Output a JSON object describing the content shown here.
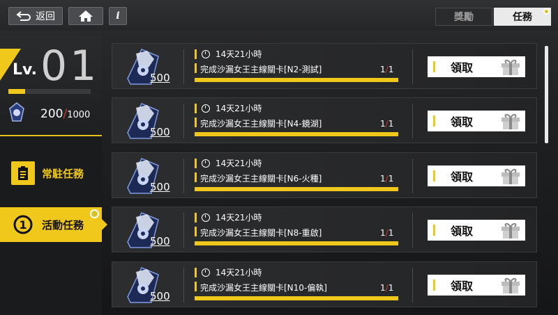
{
  "topbar": {
    "back_label": "返回",
    "info_label": "i",
    "tabs": [
      {
        "label": "獎勵",
        "active": false
      },
      {
        "label": "任務",
        "active": true
      }
    ]
  },
  "player": {
    "lv_prefix": "Lv.",
    "level": "01",
    "xp_fraction": 0.2,
    "stamina": "200",
    "stamina_max": "1000"
  },
  "sidebar": {
    "items": [
      {
        "label": "常駐任務",
        "active": false
      },
      {
        "label": "活動任務",
        "active": true
      }
    ]
  },
  "missions": [
    {
      "reward": "500",
      "time": "14天21小時",
      "desc": "完成沙漏女王主線關卡[N2-測試]",
      "progress": "1",
      "total": "1",
      "claim": "領取"
    },
    {
      "reward": "500",
      "time": "14天21小時",
      "desc": "完成沙漏女王主線關卡[N4-鏡湖]",
      "progress": "1",
      "total": "1",
      "claim": "領取"
    },
    {
      "reward": "500",
      "time": "14天21小時",
      "desc": "完成沙漏女王主線關卡[N6-火種]",
      "progress": "1",
      "total": "1",
      "claim": "領取"
    },
    {
      "reward": "500",
      "time": "14天21小時",
      "desc": "完成沙漏女王主線關卡[N8-重啟]",
      "progress": "1",
      "total": "1",
      "claim": "領取"
    },
    {
      "reward": "500",
      "time": "14天21小時",
      "desc": "完成沙漏女王主線關卡[N10-偏執]",
      "progress": "1",
      "total": "1",
      "claim": "領取"
    }
  ],
  "colors": {
    "accent": "#f0c81c",
    "alert": "#d23a2a"
  }
}
